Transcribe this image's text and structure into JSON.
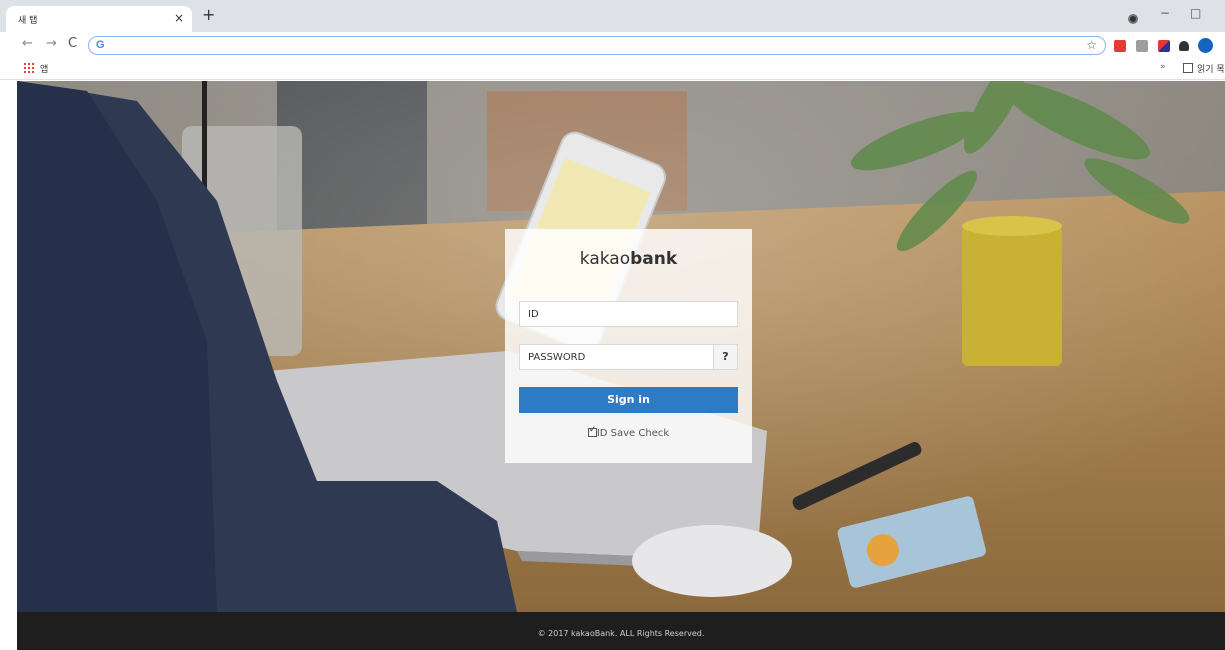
{
  "browser": {
    "tab_title": "새 탭",
    "tab_close": "×",
    "new_tab": "+",
    "minimize": "−",
    "maximize": "□",
    "back": "←",
    "forward": "→",
    "reload": "C",
    "address_icon": "G",
    "bookmark_star": "☆",
    "apps_label": "앱",
    "bookmarks_more": "»",
    "reading_list_label": "읽기 목록",
    "extension_colors": [
      "#e53935",
      "#9e9e9e",
      "#283593",
      "#333333",
      "#1565c0"
    ]
  },
  "login": {
    "logo_light": "kakao",
    "logo_bold": "bank",
    "id_placeholder": "ID",
    "password_placeholder": "PASSWORD",
    "help_label": "?",
    "signin_label": "Sign in",
    "save_check_label": "ID Save Check",
    "save_checked": true,
    "accent": "#2d7bc5"
  },
  "footer": {
    "copyright": "© 2017 kakaoBank. ALL Rights Reserved."
  }
}
